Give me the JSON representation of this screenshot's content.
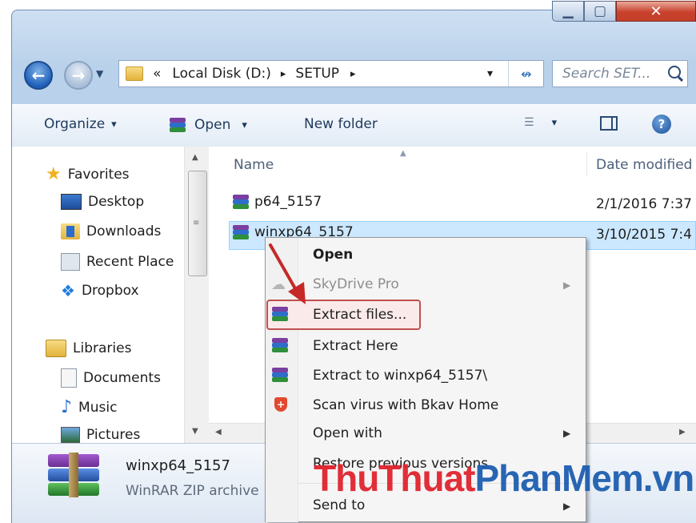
{
  "window": {
    "min_glyph": "▁",
    "max_glyph": "▢",
    "close_glyph": "✕"
  },
  "address": {
    "overflow": "«",
    "crumbs": [
      "Local Disk (D:)",
      "SETUP"
    ],
    "separator": "▸",
    "dropdown_glyph": "▾",
    "refresh_glyph": "↮"
  },
  "search": {
    "placeholder": "Search SET..."
  },
  "toolbar": {
    "organize": "Organize",
    "open": "Open",
    "new_folder": "New folder",
    "dropdown_glyph": "▾"
  },
  "nav": {
    "favorites": "Favorites",
    "items": [
      "Desktop",
      "Downloads",
      "Recent Place",
      "Dropbox"
    ],
    "libraries": "Libraries",
    "lib_items": [
      "Documents",
      "Music",
      "Pictures"
    ]
  },
  "columns": {
    "name": "Name",
    "date_modified": "Date modified"
  },
  "files": [
    {
      "name": "p64_5157",
      "date": "2/1/2016 7:37"
    },
    {
      "name": "winxp64_5157",
      "date": "3/10/2015 7:4"
    }
  ],
  "details": {
    "filename": "winxp64_5157",
    "filetype": "WinRAR ZIP archive"
  },
  "context_menu": [
    {
      "label": "Open",
      "bold": true
    },
    {
      "label": "SkyDrive Pro",
      "disabled": true,
      "submenu": true
    },
    {
      "label": "Extract files..."
    },
    {
      "label": "Extract Here"
    },
    {
      "label": "Extract to winxp64_5157\\"
    },
    {
      "label": "Scan virus with Bkav Home"
    },
    {
      "label": "Open with",
      "submenu": true
    },
    {
      "label": "Restore previous versions"
    },
    {
      "label": "Send to",
      "submenu": true
    }
  ],
  "watermark": {
    "part1": "ThuThuat",
    "part2": "PhanMem",
    "part3": ".vn"
  },
  "colors": {
    "highlight": "#c0504d",
    "watermark_red": "#e0242e",
    "watermark_blue": "#1e5fb0",
    "selection": "#cce8ff"
  }
}
